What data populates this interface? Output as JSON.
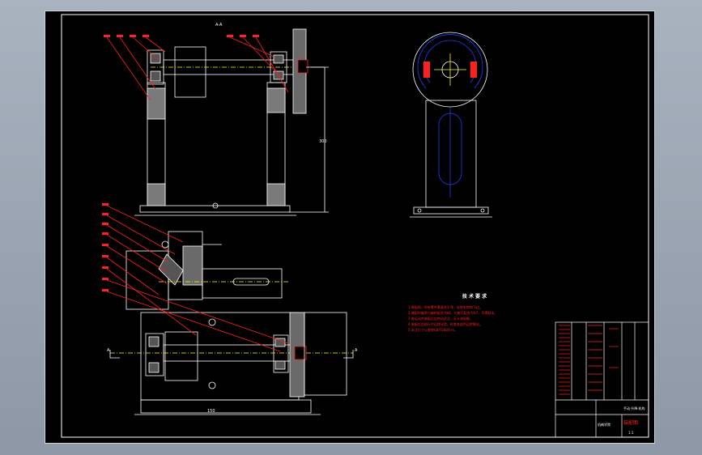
{
  "drawing": {
    "view_a_label": "A-A",
    "dim_height": "300",
    "dim_width_top": "150",
    "dim_width_bottom": "150",
    "section_mark_left": "A",
    "section_mark_right": "A"
  },
  "tech_req": {
    "title": "技 术 要 求",
    "items": [
      "1.装配前，所有零件需清洗干净，去除毛刺和飞边。",
      "2.装配时轴承与轴的配合为k6，与座孔配合为H7，不得敲击。",
      "3.各运动件装配后应转动灵活，无卡滞现象。",
      "4.装配后应进行空运转试验，检查各部件运转情况。",
      "5.未注尺寸公差按GB/T1804-m。"
    ]
  },
  "title_block": {
    "drawing_name": "手动·升降·机构",
    "material": "装配图",
    "school": "机械学院",
    "scale": "1:1"
  },
  "colors": {
    "line": "#ffffff",
    "blue": "#1f3dff",
    "red": "#ff2020",
    "green": "#20c020",
    "yellow": "#ffff00"
  }
}
